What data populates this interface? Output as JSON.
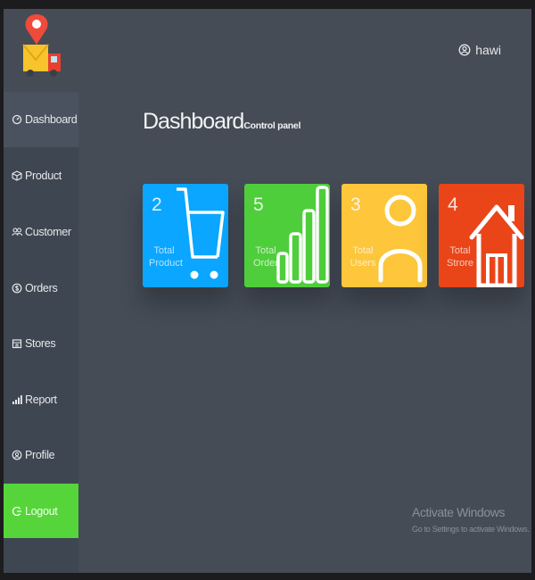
{
  "app": {
    "brand": "delivery truck logo"
  },
  "header": {
    "user_name": "hawi",
    "user_icon": "user-circle-icon"
  },
  "sidebar": {
    "items": [
      {
        "label": "Dashboard",
        "icon": "gauge-icon"
      },
      {
        "label": "Product",
        "icon": "box-icon"
      },
      {
        "label": "Customer",
        "icon": "users-icon"
      },
      {
        "label": "Orders",
        "icon": "dollar-icon"
      },
      {
        "label": "Stores",
        "icon": "store-icon"
      },
      {
        "label": "Report",
        "icon": "bar-chart-icon"
      },
      {
        "label": "Profile",
        "icon": "profile-icon"
      },
      {
        "label": "Logout",
        "icon": "logout-icon"
      }
    ]
  },
  "page": {
    "title": "Dashboard",
    "subtitle": "Control panel"
  },
  "cards": [
    {
      "count": "2",
      "label_line1": "Total",
      "label_line2": "Product",
      "color": "#0aa6ff",
      "icon": "cart-icon"
    },
    {
      "count": "5",
      "label_line1": "Total",
      "label_line2": "Order",
      "color": "#4fce3c",
      "icon": "bar-chart-icon"
    },
    {
      "count": "3",
      "label_line1": "Total",
      "label_line2": "Users",
      "color": "#fdc63b",
      "icon": "user-icon"
    },
    {
      "count": "4",
      "label_line1": "Total",
      "label_line2": "Strore",
      "color": "#ea4518",
      "icon": "house-icon"
    }
  ],
  "watermark": {
    "line1": "Activate Windows",
    "line2": "Go to Settings to activate Windows."
  },
  "colors": {
    "sidebar": "#3e4651",
    "content": "#454c56",
    "logout": "#56d53a"
  }
}
